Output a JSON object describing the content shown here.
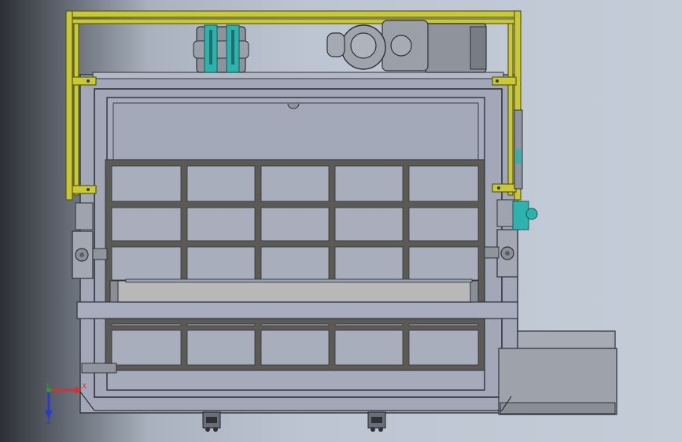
{
  "viewport": {
    "background_dark": "#2c2f35",
    "background_light": "#c4ccd8"
  },
  "model": {
    "colors": {
      "frame": "#c9c936",
      "frame_edge": "#5a5a18",
      "body": "#a2a8b8",
      "body_edge": "#2e3238",
      "grid_bar": "#5c5a55",
      "grid_cell": "#a9aebd",
      "belt": "#b8b8b8",
      "accent": "#2fb2ad",
      "motor": "#8e939c",
      "hopper": "#9ea2ab"
    }
  },
  "triad": {
    "x_label": "X",
    "y_label": "Y",
    "z_label": "Z",
    "x_color": "#d83030",
    "y_color": "#28a028",
    "z_color": "#2a3ad0"
  }
}
